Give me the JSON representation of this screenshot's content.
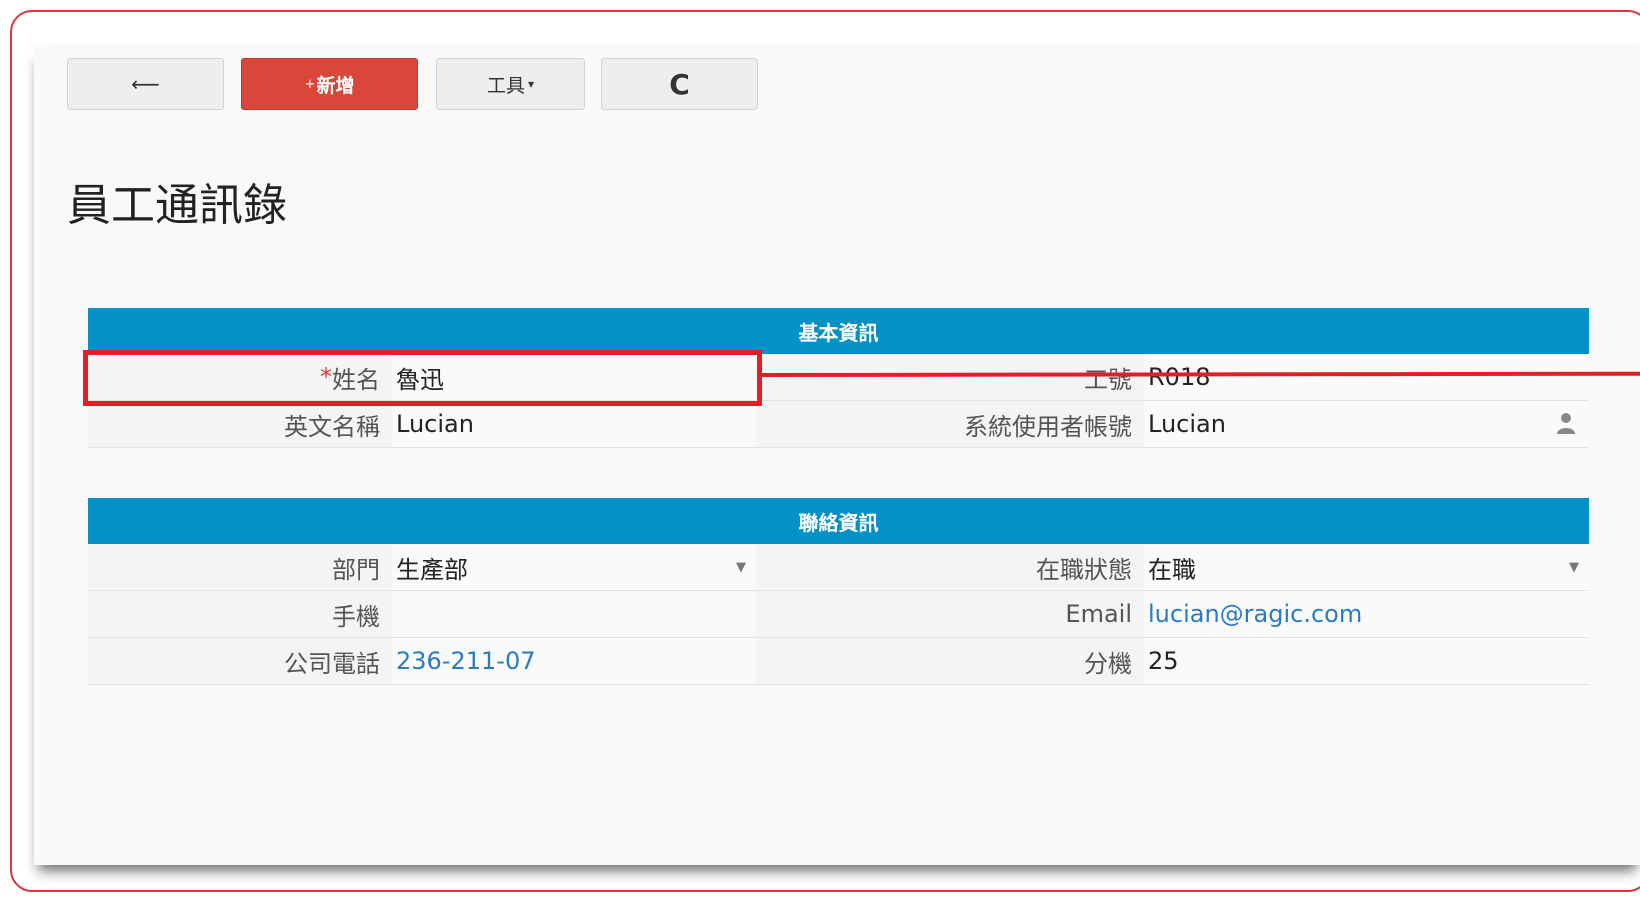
{
  "toolbar": {
    "back_icon": "arrow-left-icon",
    "back_glyph": "⟵",
    "add_plus": "+",
    "add_label": "新增",
    "tools_label": "工具",
    "tools_caret": "▾",
    "refresh_icon": "refresh-icon",
    "refresh_glyph": "C"
  },
  "page": {
    "title": "員工通訊錄"
  },
  "sections": [
    {
      "title": "基本資訊",
      "rows": [
        {
          "left_label_required": "*",
          "left_label": "姓名",
          "left_value": "魯迅",
          "right_label": "工號",
          "right_value": "R018"
        },
        {
          "left_label": "英文名稱",
          "left_value": "Lucian",
          "right_label": "系統使用者帳號",
          "right_value": "Lucian",
          "right_icon": "user-icon"
        }
      ]
    },
    {
      "title": "聯絡資訊",
      "rows": [
        {
          "left_label": "部門",
          "left_value": "生產部",
          "right_label": "在職狀態",
          "right_value": "在職"
        },
        {
          "left_label": "手機",
          "left_value": "",
          "right_label": "Email",
          "right_value": "lucian@ragic.com"
        },
        {
          "left_label": "公司電話",
          "left_value": "236-211-07",
          "right_label": "分機",
          "right_value": "25"
        }
      ]
    }
  ],
  "colors": {
    "accent": "#0590c6",
    "add_button": "#d9473b",
    "highlight": "#e41e26",
    "link": "#2a7bc4"
  }
}
